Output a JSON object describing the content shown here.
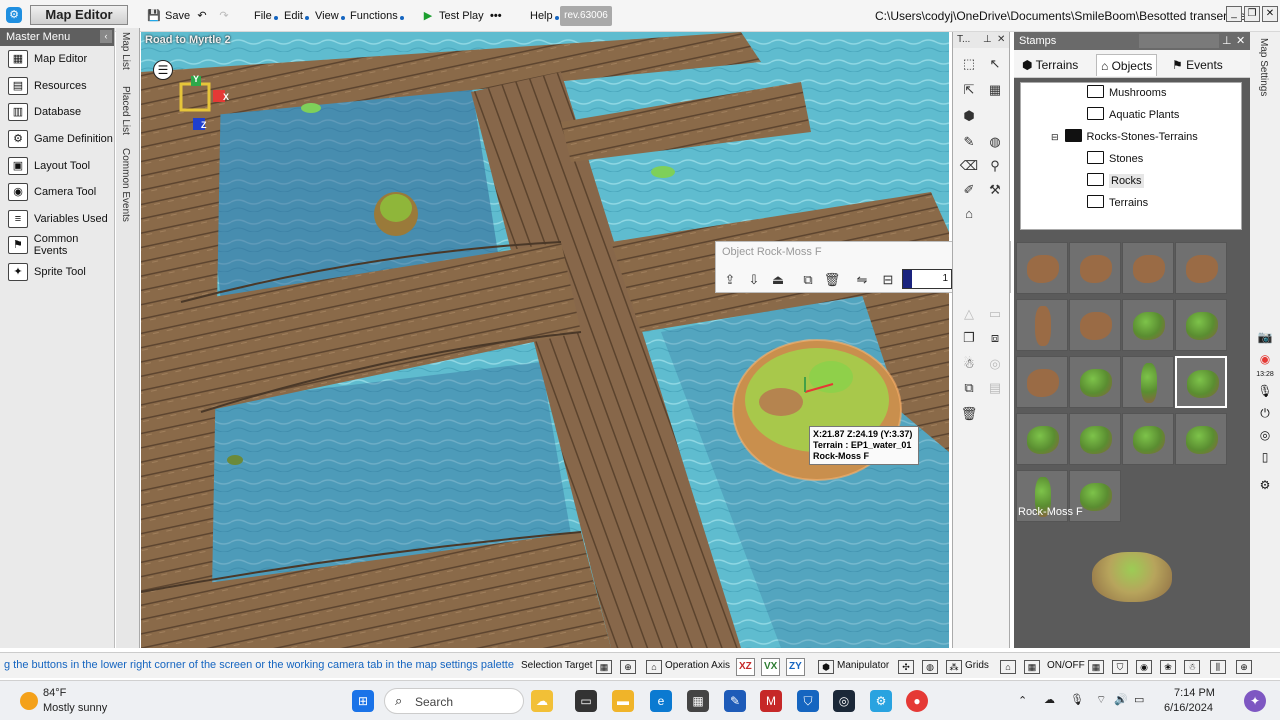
{
  "app": {
    "title": "Map Editor",
    "toolbar": {
      "save_label": "Save",
      "menus": [
        "File",
        "Edit",
        "View",
        "Functions"
      ],
      "test_play_label": "Test Play",
      "help_label": "Help",
      "revision": "rev.63006",
      "file_path": "C:\\Users\\codyj\\OneDrive\\Documents\\SmileBoom\\Besotted transer file"
    }
  },
  "master_menu": {
    "header": "Master Menu",
    "items": [
      {
        "label": "Map Editor",
        "icon": "map-icon"
      },
      {
        "label": "Resources",
        "icon": "resources-icon"
      },
      {
        "label": "Database",
        "icon": "database-icon"
      },
      {
        "label": "Game Definition",
        "icon": "game-definition-icon"
      },
      {
        "label": "Layout Tool",
        "icon": "layout-icon"
      },
      {
        "label": "Camera Tool",
        "icon": "camera-icon"
      },
      {
        "label": "Variables Used",
        "icon": "variables-icon"
      },
      {
        "label": "Common Events",
        "icon": "events-icon"
      },
      {
        "label": "Sprite Tool",
        "icon": "sprite-icon"
      }
    ]
  },
  "side_tabs": [
    "Map List",
    "Placed List",
    "Common Events"
  ],
  "viewport": {
    "map_name": "Road to Myrtle 2",
    "gizmo_labels": {
      "y": "Y",
      "x": "X",
      "z": "Z"
    },
    "tooltip": {
      "coords": "X:21.87 Z:24.19 (Y:3.37)",
      "terrain": "Terrain : EP1_water_01",
      "object": "Rock-Moss F"
    }
  },
  "object_panel": {
    "title": "Object Rock-Moss F",
    "value": "1",
    "slider_fraction": 0.18
  },
  "tools_panel": {
    "header": "T..."
  },
  "stamps": {
    "header": "Stamps",
    "tabs": [
      {
        "label": "Terrains",
        "icon": "terrain-icon"
      },
      {
        "label": "Objects",
        "icon": "objects-icon",
        "active": true
      },
      {
        "label": "Events",
        "icon": "events-icon"
      }
    ],
    "tree": [
      {
        "label": "Mushrooms",
        "indent": 2
      },
      {
        "label": "Aquatic Plants",
        "indent": 2
      },
      {
        "label": "Rocks-Stones-Terrains",
        "indent": 1,
        "open": true
      },
      {
        "label": "Stones",
        "indent": 2
      },
      {
        "label": "Rocks",
        "indent": 2,
        "selected": true
      },
      {
        "label": "Terrains",
        "indent": 2
      }
    ],
    "thumbnails": [
      "rock",
      "rock",
      "rock",
      "rock",
      "tall",
      "rock",
      "moss",
      "moss",
      "rock",
      "moss",
      "moss-tall",
      "moss-selected",
      "moss",
      "moss",
      "moss",
      "moss",
      "moss-tall",
      "moss"
    ],
    "preview_label": "Rock-Moss F"
  },
  "statusbar": {
    "hint": "g the buttons in the lower right corner of the screen or the working camera tab in the map settings palette",
    "selection_target": "Selection Target",
    "operation_axis": "Operation Axis",
    "axis_xz": "XZ",
    "axis_vx": "VX",
    "axis_zy": "ZY",
    "manipulator": "Manipulator",
    "grids": "Grids",
    "on_off": "ON/OFF"
  },
  "taskbar": {
    "temperature": "84°F",
    "weather": "Mostly sunny",
    "search_placeholder": "Search",
    "time": "7:14 PM",
    "date": "6/16/2024"
  },
  "right_strip": {
    "clock": "13:28"
  }
}
